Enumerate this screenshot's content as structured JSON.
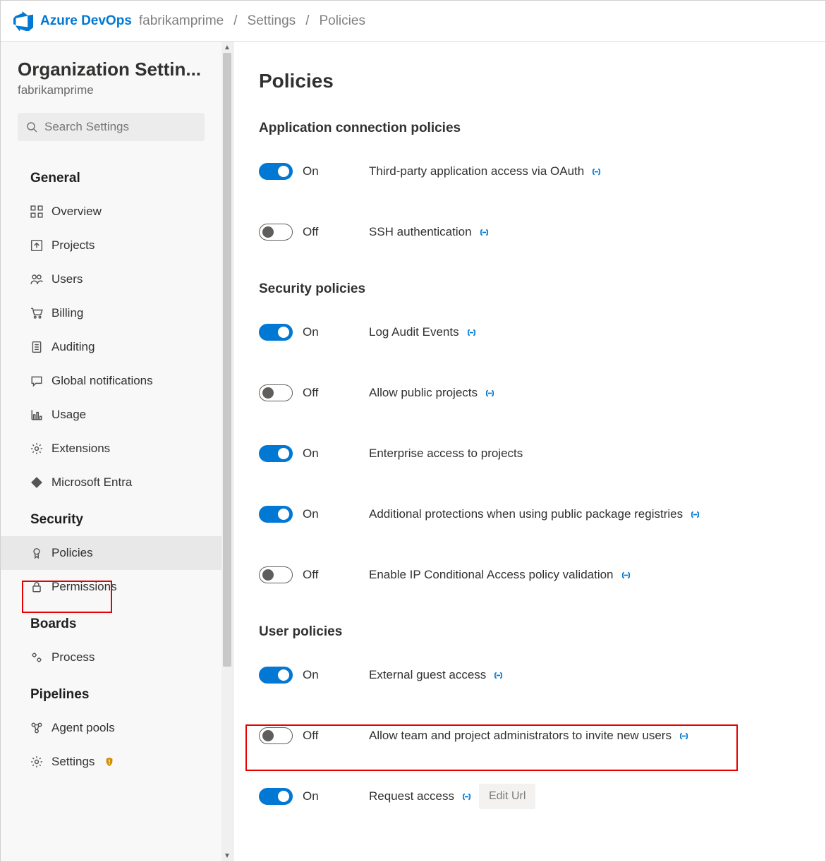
{
  "brand": "Azure DevOps",
  "breadcrumb": {
    "org": "fabrikamprime",
    "settings": "Settings",
    "page": "Policies"
  },
  "sidebar": {
    "title": "Organization Settin...",
    "subtitle": "fabrikamprime",
    "search_placeholder": "Search Settings",
    "groups": {
      "general": {
        "label": "General",
        "items": [
          "Overview",
          "Projects",
          "Users",
          "Billing",
          "Auditing",
          "Global notifications",
          "Usage",
          "Extensions",
          "Microsoft Entra"
        ]
      },
      "security": {
        "label": "Security",
        "items": [
          "Policies",
          "Permissions"
        ]
      },
      "boards": {
        "label": "Boards",
        "items": [
          "Process"
        ]
      },
      "pipelines": {
        "label": "Pipelines",
        "items": [
          "Agent pools",
          "Settings"
        ]
      }
    }
  },
  "page_title": "Policies",
  "toggle_labels": {
    "on": "On",
    "off": "Off"
  },
  "sections": {
    "app": {
      "title": "Application connection policies",
      "policies": [
        {
          "on": true,
          "label": "Third-party application access via OAuth",
          "link": true
        },
        {
          "on": false,
          "label": "SSH authentication",
          "link": true
        }
      ]
    },
    "sec": {
      "title": "Security policies",
      "policies": [
        {
          "on": true,
          "label": "Log Audit Events",
          "link": true
        },
        {
          "on": false,
          "label": "Allow public projects",
          "link": true
        },
        {
          "on": true,
          "label": "Enterprise access to projects",
          "link": false
        },
        {
          "on": true,
          "label": "Additional protections when using public package registries",
          "link": true
        },
        {
          "on": false,
          "label": "Enable IP Conditional Access policy validation",
          "link": true
        }
      ]
    },
    "user": {
      "title": "User policies",
      "policies": [
        {
          "on": true,
          "label": "External guest access",
          "link": true
        },
        {
          "on": false,
          "label": "Allow team and project administrators to invite new users",
          "link": true
        },
        {
          "on": true,
          "label": "Request access",
          "link": true,
          "edit_url": "Edit Url"
        }
      ]
    }
  }
}
